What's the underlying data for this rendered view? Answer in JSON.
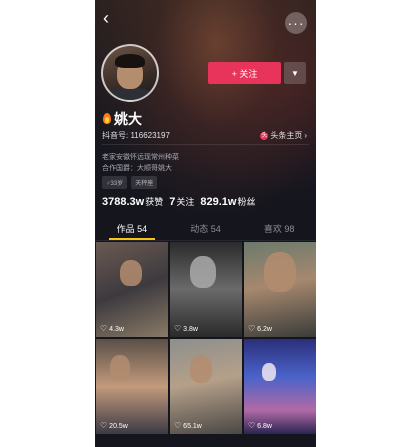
{
  "header": {
    "back_icon": "chevron-left-icon",
    "more_icon": "more-dots-icon"
  },
  "profile": {
    "follow_label": "+ 关注",
    "name": "姚大",
    "douyin_id": "抖音号: 116623197",
    "toutiao_link": "头条主页",
    "bio_line1": "老家安徽怀远现常州种菜",
    "bio_line2": "合作国爵：大顺哥姚大",
    "tags": [
      "♂33岁",
      "天秤座"
    ]
  },
  "stats": [
    {
      "num": "3788.3w",
      "label": "获赞"
    },
    {
      "num": "7",
      "label": "关注"
    },
    {
      "num": "829.1w",
      "label": "粉丝"
    }
  ],
  "tabs": [
    {
      "label": "作品 54",
      "active": true
    },
    {
      "label": "动态 54",
      "active": false
    },
    {
      "label": "喜欢 98",
      "active": false
    }
  ],
  "videos": [
    {
      "likes": "4.3w"
    },
    {
      "likes": "3.8w"
    },
    {
      "likes": "6.2w"
    },
    {
      "likes": "20.5w"
    },
    {
      "likes": "65.1w"
    },
    {
      "likes": "6.8w"
    }
  ],
  "colors": {
    "follow_button": "#e8335a",
    "tab_indicator": "#f5c518",
    "background": "#14151d"
  }
}
